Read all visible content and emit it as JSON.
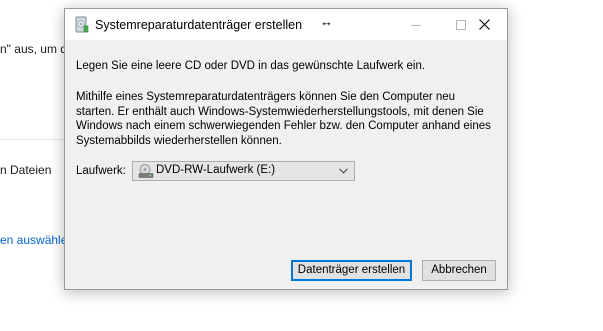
{
  "background": {
    "fragment_1": "n\" aus, um d",
    "fragment_2": "n Dateien",
    "link_fragment": "en auswähle"
  },
  "dialog": {
    "title": "Systemreparaturdatenträger erstellen",
    "title_icon": "disc-repair-icon",
    "window_controls": [
      "minimize-icon",
      "maximize-icon",
      "close-icon"
    ],
    "instruction": "Legen Sie eine leere CD oder DVD in das gewünschte Laufwerk ein.",
    "description_lines": [
      "Mithilfe eines Systemreparaturdatenträgers können Sie den Computer neu",
      "starten. Er enthält auch Windows-Systemwiederherstellungstools, mit denen Sie",
      "Windows nach einem schwerwiegenden Fehler bzw. den Computer anhand eines",
      "Systemabbilds wiederherstellen können."
    ],
    "drive_label": "Laufwerk:",
    "drive_value": "DVD-RW-Laufwerk (E:)",
    "drive_icon": "dvd-drive-icon",
    "create_button": "Datenträger erstellen",
    "cancel_button": "Abbrechen"
  },
  "colors": {
    "dialog_background": "#f0f0f0",
    "titlebar": "#ffffff",
    "default_button_border": "#0078d7",
    "link": "#0066cc"
  }
}
